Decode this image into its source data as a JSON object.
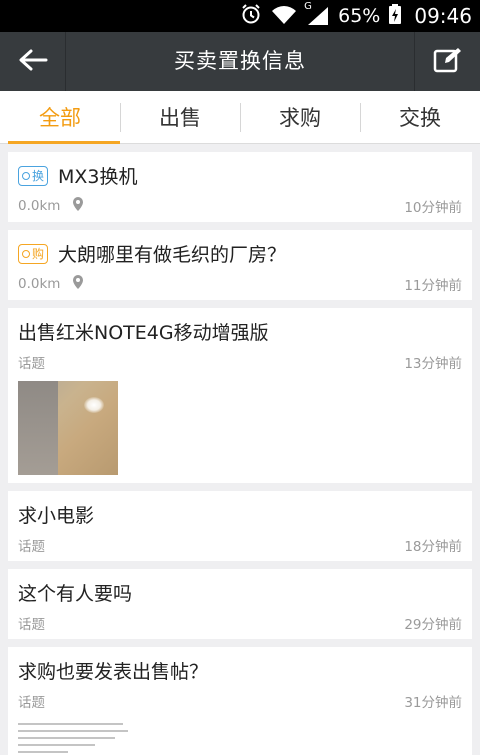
{
  "status_bar": {
    "network_label": "G",
    "battery": "65%",
    "time": "09:46",
    "icons": [
      "alarm-icon",
      "wifi-icon",
      "signal-icon",
      "battery-charging-icon"
    ]
  },
  "header": {
    "title": "买卖置换信息",
    "back_icon": "arrow-left-icon",
    "edit_icon": "edit-icon"
  },
  "tabs": [
    {
      "label": "全部",
      "active": true
    },
    {
      "label": "出售",
      "active": false
    },
    {
      "label": "求购",
      "active": false
    },
    {
      "label": "交换",
      "active": false
    }
  ],
  "accent_color": "#f5a623",
  "posts": [
    {
      "badge": "换",
      "badge_type": "swap",
      "title": "MX3换机",
      "distance": "0.0km",
      "time": "10分钟前"
    },
    {
      "badge": "购",
      "badge_type": "buy",
      "title": "大朗哪里有做毛织的厂房？",
      "distance": "0.0km",
      "time": "11分钟前"
    },
    {
      "title": "出售红米NOTE4G移动增强版",
      "category": "话题",
      "time": "13分钟前"
    },
    {
      "title": "求小电影",
      "category": "话题",
      "time": "18分钟前"
    },
    {
      "title": "这个有人要吗",
      "category": "话题",
      "time": "29分钟前"
    },
    {
      "title": "求购也要发表出售帖？",
      "category": "话题",
      "time": "31分钟前"
    }
  ]
}
